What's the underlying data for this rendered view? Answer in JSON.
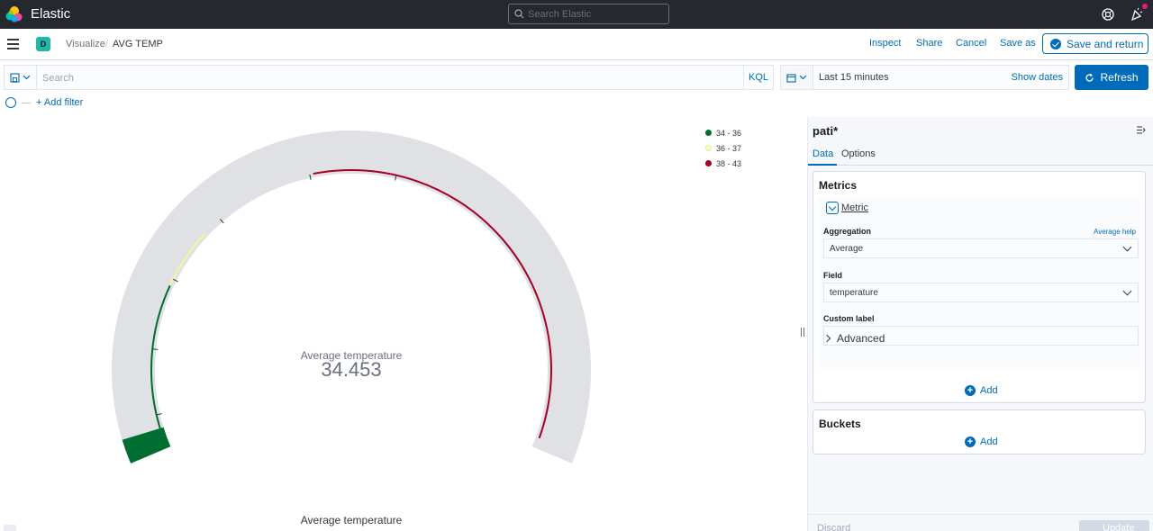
{
  "header": {
    "app_title": "Elastic",
    "search_placeholder": "Search Elastic",
    "icons": [
      "elastic-logo-icon",
      "search-icon",
      "help-icon",
      "newsfeed-icon"
    ]
  },
  "nav": {
    "space_badge": "D",
    "breadcrumbs": [
      "Visualize",
      "AVG TEMP"
    ],
    "separator": "/",
    "links": {
      "inspect": "Inspect",
      "share": "Share",
      "cancel": "Cancel",
      "save_as": "Save as"
    },
    "save_return": "Save and return"
  },
  "query": {
    "placeholder": "Search",
    "language": "KQL",
    "date_range": "Last 15 minutes",
    "show_dates": "Show dates",
    "refresh": "Refresh",
    "add_filter": "+ Add filter"
  },
  "visualization": {
    "type": "gauge",
    "metric_label": "Average temperature",
    "value": "34.453",
    "title": "Average temperature",
    "legend": [
      {
        "label": "34 - 36",
        "color": "#006e30"
      },
      {
        "label": "36 - 37",
        "color": "#ffffbe"
      },
      {
        "label": "38 - 43",
        "color": "#a50026"
      }
    ],
    "colors": {
      "track": "#e0e1e5",
      "fill": "#006e30"
    }
  },
  "sidebar": {
    "index_pattern": "pati*",
    "tabs": [
      "Data",
      "Options"
    ],
    "metrics": {
      "title": "Metrics",
      "metric_name": "Metric",
      "aggregation_label": "Aggregation",
      "aggregation_help": "Average help",
      "aggregation_value": "Average",
      "field_label": "Field",
      "field_value": "temperature",
      "custom_label": "Custom label",
      "custom_label_value": "",
      "advanced": "Advanced",
      "add": "Add"
    },
    "buckets": {
      "title": "Buckets",
      "add": "Add"
    },
    "footer": {
      "discard": "Discard",
      "update": "Update"
    }
  }
}
